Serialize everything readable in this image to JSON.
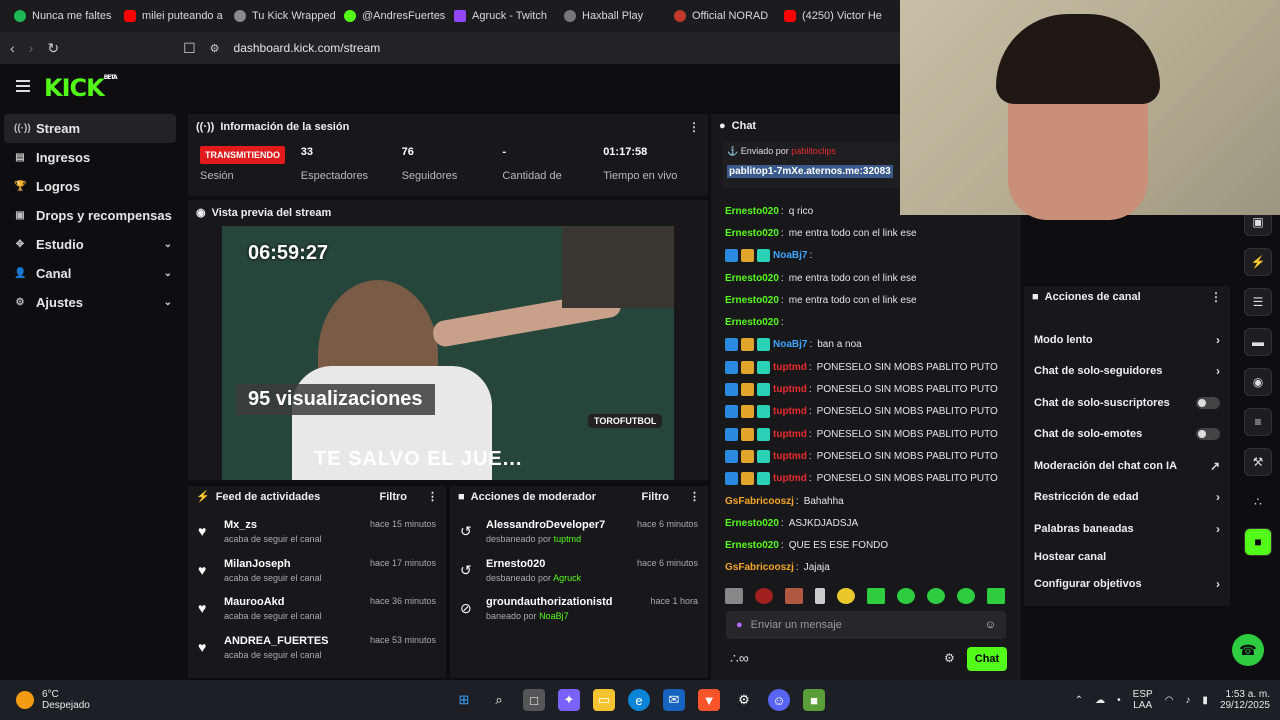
{
  "browser": {
    "tabs": [
      {
        "label": "Nunca me faltes",
        "color": "#1db954"
      },
      {
        "label": "milei puteando a",
        "color": "#ff0000"
      },
      {
        "label": "Tu Kick Wrapped",
        "color": "#888888"
      },
      {
        "label": "@AndresFuertes",
        "color": "#53fc18"
      },
      {
        "label": "Agruck - Twitch",
        "color": "#9146ff"
      },
      {
        "label": "Haxball Play",
        "color": "#777777"
      },
      {
        "label": "Official NORAD",
        "color": "#c0392b"
      },
      {
        "label": "(4250) Victor He",
        "color": "#ff0000"
      }
    ],
    "url": "dashboard.kick.com/stream"
  },
  "brand": {
    "logo": "KICK",
    "beta": "BETA",
    "accent": "#53fc18"
  },
  "sidebar": {
    "items": [
      {
        "label": "Stream",
        "icon": "broadcast-icon"
      },
      {
        "label": "Ingresos",
        "icon": "chart-icon"
      },
      {
        "label": "Logros",
        "icon": "trophy-icon"
      },
      {
        "label": "Drops y recompensas",
        "icon": "gift-icon"
      },
      {
        "label": "Estudio",
        "icon": "grid-icon"
      },
      {
        "label": "Canal",
        "icon": "user-icon"
      },
      {
        "label": "Ajustes",
        "icon": "gear-icon"
      }
    ]
  },
  "session": {
    "title": "Información de la sesión",
    "live_badge": "TRANSMITIENDO",
    "stats": [
      {
        "value": "",
        "label": "Sesión"
      },
      {
        "value": "33",
        "label": "Espectadores"
      },
      {
        "value": "76",
        "label": "Seguidores"
      },
      {
        "value": "-",
        "label": "Cantidad de"
      },
      {
        "value": "01:17:58",
        "label": "Tiempo en vivo"
      }
    ]
  },
  "preview": {
    "title": "Vista previa del stream",
    "clock": "06:59:27",
    "views": "95 visualizaciones",
    "caption": "TE SALVO EL JUE...",
    "tag": "TOROFUTBOL"
  },
  "feed": {
    "title": "Feed de actividades",
    "filter": "Filtro",
    "items": [
      {
        "name": "Mx_zs",
        "action": "acaba de seguir el canal",
        "time": "hace 15 minutos"
      },
      {
        "name": "MilanJoseph",
        "action": "acaba de seguir el canal",
        "time": "hace 17 minutos"
      },
      {
        "name": "MaurooAkd",
        "action": "acaba de seguir el canal",
        "time": "hace 36 minutos"
      },
      {
        "name": "ANDREA_FUERTES",
        "action": "acaba de seguir el canal",
        "time": "hace 53 minutos"
      }
    ]
  },
  "mod": {
    "title": "Acciones de moderador",
    "filter": "Filtro",
    "items": [
      {
        "name": "AlessandroDeveloper7",
        "action": "desbaneado por",
        "by": "tuptmd",
        "time": "hace 6 minutos"
      },
      {
        "name": "Ernesto020",
        "action": "desbaneado por",
        "by": "Agruck",
        "time": "hace 6 minutos"
      },
      {
        "name": "groundauthorizationistd",
        "action": "baneado por",
        "by": "NoaBj7",
        "time": "hace 1 hora"
      }
    ]
  },
  "chat": {
    "title": "Chat",
    "pinned_by_label": "Enviado por",
    "pinned_by": "pablitoclips",
    "pinned_text": "pablitop1-7mXe.aternos.me:32083",
    "messages": [
      {
        "user": "Ernesto020",
        "text": "q rico",
        "color": "green",
        "badges": false
      },
      {
        "user": "Ernesto020",
        "text": "me entra todo con el link ese",
        "color": "green",
        "badges": false
      },
      {
        "user": "NoaBj7",
        "text": "",
        "color": "blue",
        "badges": true
      },
      {
        "user": "Ernesto020",
        "text": "me entra todo con el link ese",
        "color": "green",
        "badges": false
      },
      {
        "user": "Ernesto020",
        "text": "me entra todo con el link ese",
        "color": "green",
        "badges": false
      },
      {
        "user": "Ernesto020",
        "text": "",
        "color": "green",
        "badges": false
      },
      {
        "user": "NoaBj7",
        "text": "ban a noa",
        "color": "blue",
        "badges": true
      },
      {
        "user": "tuptmd",
        "text": "PONESELO SIN MOBS PABLITO PUTO",
        "color": "red",
        "badges": true
      },
      {
        "user": "tuptmd",
        "text": "PONESELO SIN MOBS PABLITO PUTO",
        "color": "red",
        "badges": true
      },
      {
        "user": "tuptmd",
        "text": "PONESELO SIN MOBS PABLITO PUTO",
        "color": "red",
        "badges": true
      },
      {
        "user": "tuptmd",
        "text": "PONESELO SIN MOBS PABLITO PUTO",
        "color": "red",
        "badges": true
      },
      {
        "user": "tuptmd",
        "text": "PONESELO SIN MOBS PABLITO PUTO",
        "color": "red",
        "badges": true
      },
      {
        "user": "tuptmd",
        "text": "PONESELO SIN MOBS PABLITO PUTO",
        "color": "red",
        "badges": true
      },
      {
        "user": "GsFabricooszj",
        "text": "Bahahha",
        "color": "orange",
        "badges": false
      },
      {
        "user": "Ernesto020",
        "text": "ASJKDJADSJA",
        "color": "green",
        "badges": false
      },
      {
        "user": "Ernesto020",
        "text": "QUE ES ESE FONDO",
        "color": "green",
        "badges": false
      },
      {
        "user": "GsFabricooszj",
        "text": "Jajaja",
        "color": "orange",
        "badges": false
      }
    ],
    "input_placeholder": "Enviar un mensaje",
    "send_label": "Chat"
  },
  "channel_actions": {
    "title": "Acciones de canal",
    "items": [
      {
        "label": "Modo lento",
        "control": "chevron"
      },
      {
        "label": "Chat de solo-seguidores",
        "control": "chevron"
      },
      {
        "label": "Chat de solo-suscriptores",
        "control": "toggle"
      },
      {
        "label": "Chat de solo-emotes",
        "control": "toggle"
      },
      {
        "label": "Moderación del chat con IA",
        "control": "external"
      },
      {
        "label": "Restricción de edad",
        "control": "chevron"
      },
      {
        "label": "Palabras baneadas",
        "control": "chevron"
      },
      {
        "label": "Hostear canal",
        "control": "none"
      },
      {
        "label": "Configurar objetivos",
        "control": "chevron"
      }
    ]
  },
  "taskbar": {
    "weather_temp": "6°C",
    "weather_desc": "Despejado",
    "lang_top": "ESP",
    "lang_bottom": "LAA",
    "time": "1:53 a. m.",
    "date": "29/12/2025"
  }
}
